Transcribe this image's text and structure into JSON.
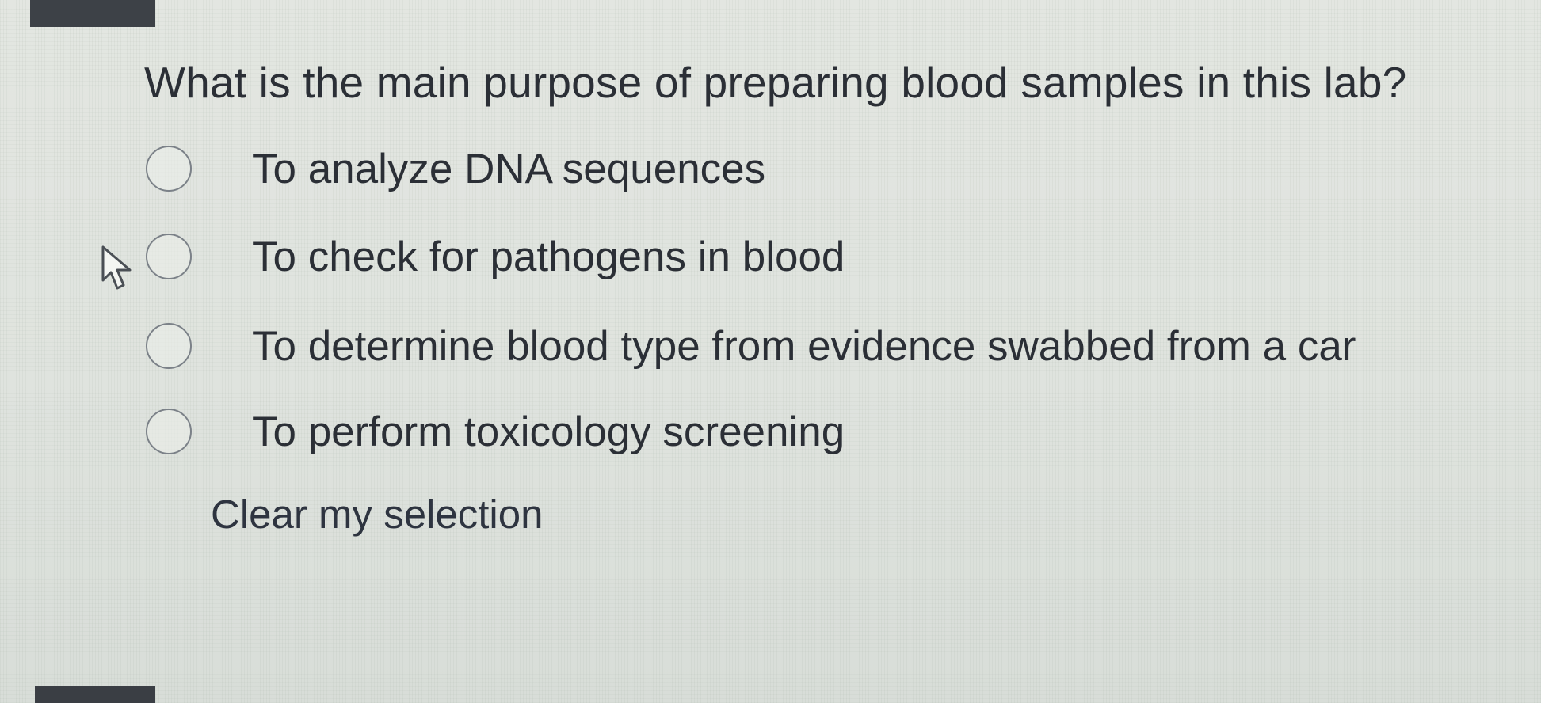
{
  "question": {
    "text": "What is the main purpose of preparing blood samples in this lab?"
  },
  "options": [
    {
      "label": "To analyze DNA sequences",
      "selected": false
    },
    {
      "label": "To check for pathogens in blood",
      "selected": false
    },
    {
      "label": "To determine blood type from evidence swabbed from a car",
      "selected": false
    },
    {
      "label": "To perform toxicology screening",
      "selected": false
    }
  ],
  "clear_link": {
    "label": "Clear my selection"
  },
  "icons": {
    "cursor": "mouse-pointer-icon",
    "radio": "radio-button-icon"
  }
}
